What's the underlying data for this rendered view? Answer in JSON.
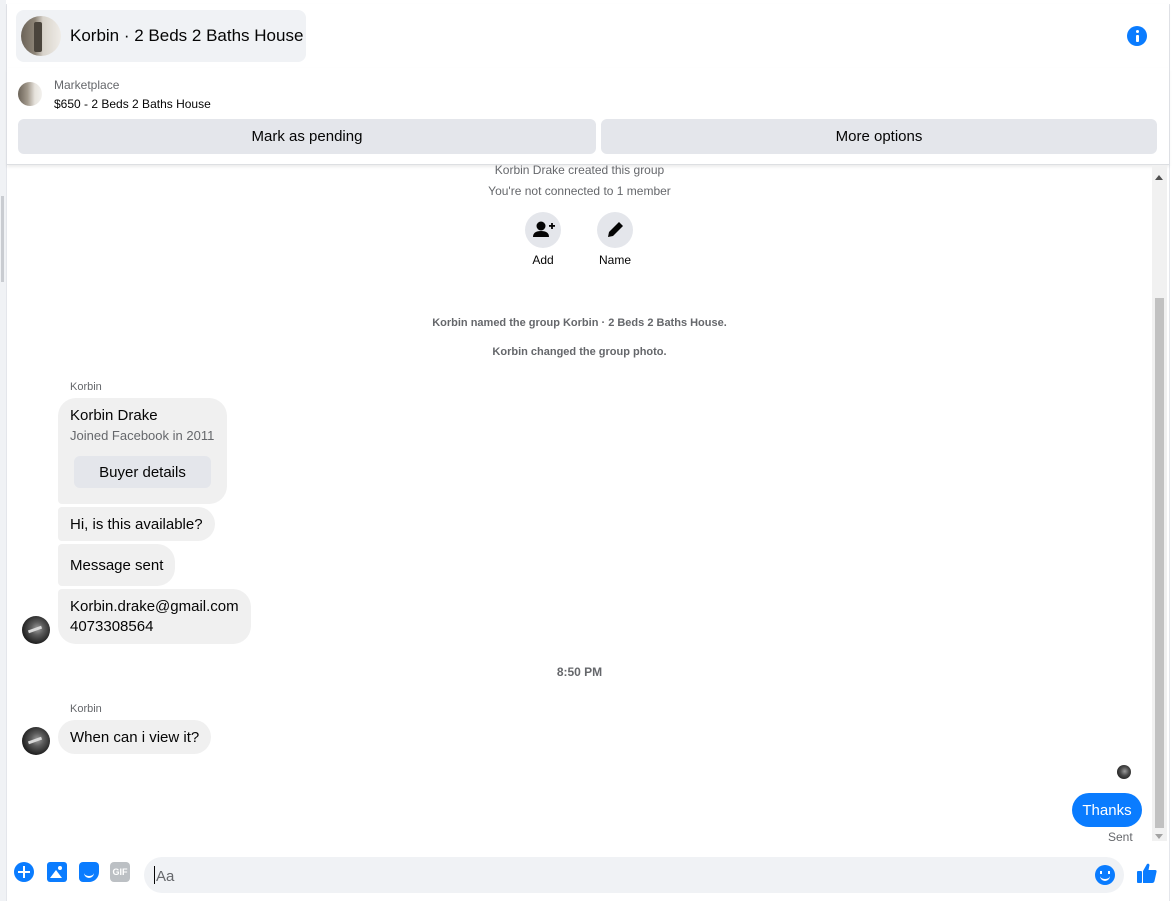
{
  "header": {
    "title": "Korbin · 2 Beds 2 Baths House",
    "info_icon": "info-circle-icon"
  },
  "marketplace": {
    "label": "Marketplace",
    "listing": "$650 - 2 Beds 2 Baths House",
    "mark_pending_label": "Mark as pending",
    "more_options_label": "More options"
  },
  "chat": {
    "created_notice": "Korbin Drake created this group",
    "connection_notice": "You're not connected to 1 member",
    "actions": [
      {
        "label": "Add",
        "icon": "add-person-icon"
      },
      {
        "label": "Name",
        "icon": "pencil-icon"
      }
    ],
    "renamed_notice": "Korbin named the group Korbin · 2 Beds 2 Baths House.",
    "photo_notice": "Korbin changed the group photo.",
    "first_group": {
      "sender": "Korbin",
      "profile_card": {
        "name": "Korbin Drake",
        "since": "Joined Facebook in 2011",
        "button_label": "Buyer details"
      },
      "messages": [
        "Hi, is this available?",
        "Message sent",
        "Korbin.drake@gmail.com",
        "4073308564"
      ]
    },
    "timestamp": "8:50 PM",
    "second_group": {
      "sender": "Korbin",
      "message": "When can i view it?"
    },
    "outgoing": {
      "message": "Thanks",
      "status": "Sent"
    }
  },
  "composer": {
    "placeholder": "Aa",
    "icons": [
      "plus-icon",
      "photo-icon",
      "sticker-icon",
      "gif-icon",
      "emoji-icon",
      "like-icon"
    ],
    "gif_label": "GIF"
  },
  "colors": {
    "accent": "#0a7cff",
    "bubble_incoming": "#f0f0f0",
    "button_gray": "#e4e6eb",
    "secondary_text": "#65676b"
  }
}
